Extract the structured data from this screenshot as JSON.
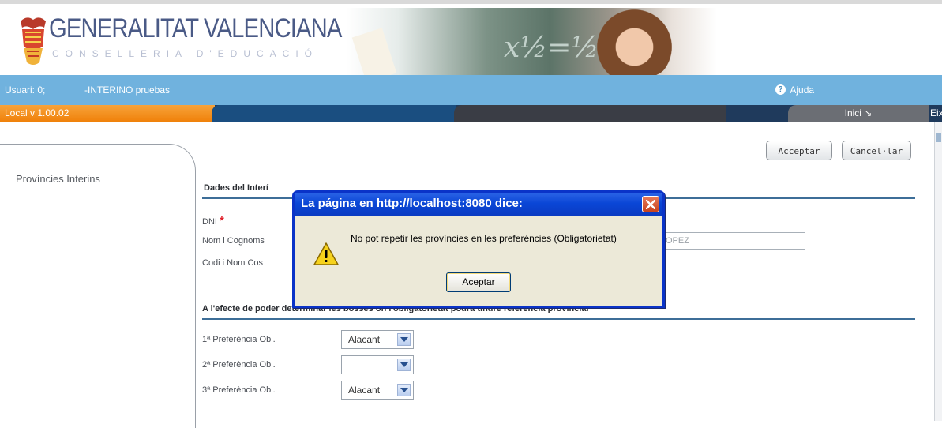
{
  "header": {
    "logo_title": "GENERALITAT VALENCIANA",
    "logo_subtitle": "CONSELLERIA D'EDUCACIÓ",
    "banner_scribble": "x½=½"
  },
  "userbar": {
    "user_label": "Usuari: 0;",
    "user_name": "-INTERINO pruebas",
    "help_label": "Ajuda",
    "help_icon": "?"
  },
  "tabs": {
    "version": "Local v 1.00.02",
    "inici": "Inici ↘",
    "eixir": "Eixir"
  },
  "sidebar": {
    "items": [
      {
        "label": "Províncies Interins"
      }
    ]
  },
  "toolbar": {
    "accept_label": "Acceptar",
    "cancel_label": "Cancel·lar"
  },
  "form": {
    "section1_title": "Dades del Interí",
    "dni_label": "DNI",
    "required_marker": "*",
    "nom_label": "Nom i Cognoms",
    "nom_value_visible": "OPEZ",
    "codi_label": "Codi i Nom Cos",
    "section2_title": "A l'efecte de poder determinar les bosses on l'obligatorietat podrà tindre referència provincial",
    "preferences": [
      {
        "label": "1ª Preferència Obl.",
        "value": "Alacant"
      },
      {
        "label": "2ª Preferència Obl.",
        "value": ""
      },
      {
        "label": "3ª Preferència Obl.",
        "value": "Alacant"
      }
    ]
  },
  "dialog": {
    "title": "La página en http://localhost:8080 dice:",
    "message": "No pot repetir les províncies en les preferències (Obligatorietat)",
    "ok_label": "Aceptar",
    "icon": "warning-icon",
    "close_icon": "close-icon"
  },
  "colors": {
    "userbar": "#70b2de",
    "version_tab": "#f0810a",
    "tabstrip": "#1f3a5c",
    "section_rule": "#3d6e98",
    "dialog_title": "#0a46d6"
  }
}
